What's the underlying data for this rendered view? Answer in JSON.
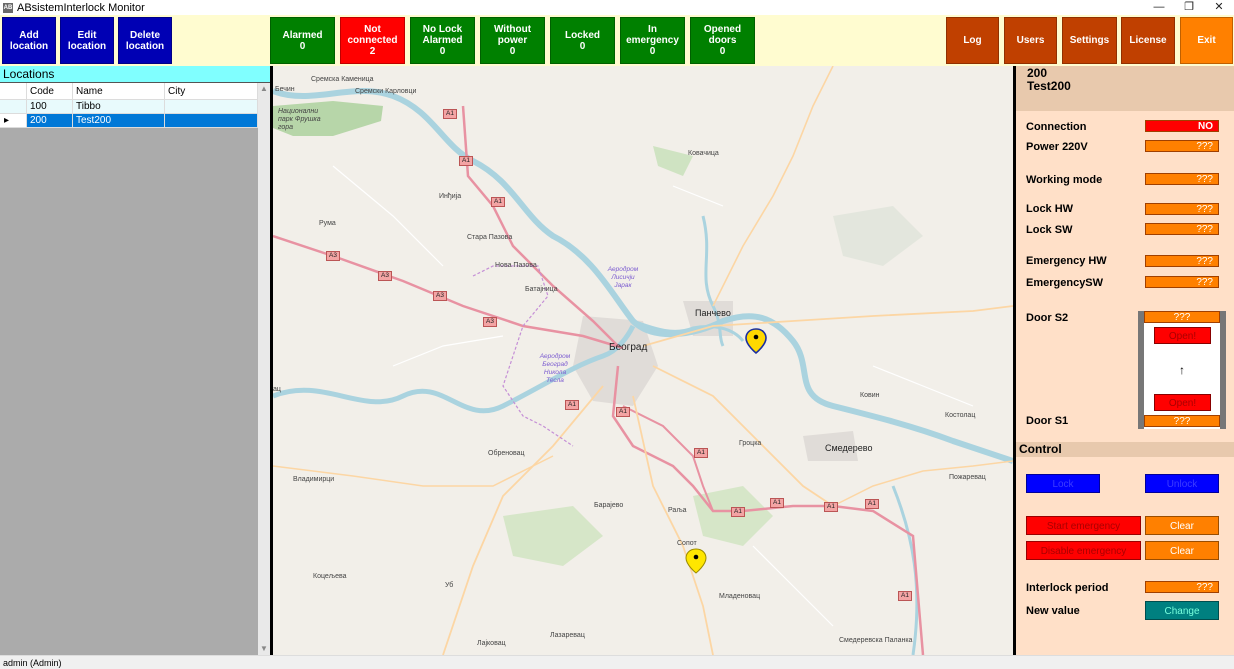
{
  "window": {
    "title": "ABsistemInterlock Monitor",
    "icon_text": "AB",
    "controls": [
      "minimize-icon",
      "maximize-icon",
      "close-icon"
    ]
  },
  "toolbar": {
    "add_location": [
      "Add",
      "location"
    ],
    "edit_location": [
      "Edit",
      "location"
    ],
    "delete_location": [
      "Delete",
      "location"
    ],
    "alarmed": {
      "label": "Alarmed",
      "count": "0"
    },
    "not_connected": {
      "label": [
        "Not",
        "connected"
      ],
      "count": "2"
    },
    "no_lock_alarmed": {
      "label": [
        "No Lock",
        "Alarmed"
      ],
      "count": "0"
    },
    "without_power": {
      "label": [
        "Without",
        "power"
      ],
      "count": "0"
    },
    "locked": {
      "label": "Locked",
      "count": "0"
    },
    "in_emergency": {
      "label": [
        "In",
        "emergency"
      ],
      "count": "0"
    },
    "opened_doors": {
      "label": [
        "Opened",
        "doors"
      ],
      "count": "0"
    },
    "log": "Log",
    "users": "Users",
    "settings": "Settings",
    "license": "License",
    "exit": "Exit"
  },
  "locations": {
    "title": "Locations",
    "columns": [
      "Code",
      "Name",
      "City"
    ],
    "rows": [
      {
        "code": "100",
        "name": "Tibbo",
        "city": ""
      },
      {
        "code": "200",
        "name": "Test200",
        "city": ""
      }
    ],
    "selected_row_marker": "▸"
  },
  "map": {
    "labels": {
      "sremska_kamenica": "Сремска Каменица",
      "sremski_karlovci": "Сремски Карловци",
      "becin": "Бечин",
      "nac_park": "Национални парк Фрушка гора",
      "kovacica": "Ковачица",
      "indjija": "Инђија",
      "ruma": "Рума",
      "stara_pazova": "Стара Пазова",
      "nova_pazova": "Нова Пазова",
      "batajnica": "Батајница",
      "pancevo": "Панчево",
      "beograd": "Београд",
      "obrenovac": "Обреновац",
      "kovin": "Ковин",
      "kostolac": "Костолац",
      "grocka": "Гроцка",
      "smederevo": "Смедерево",
      "vladimirci": "Владимирци",
      "pozarevac": "Пожаревац",
      "barajevo": "Барајево",
      "ralja": "Раља",
      "sopot": "Сопот",
      "koceljeva": "Коцељева",
      "ub": "Уб",
      "mladenovac": "Младеновац",
      "lajkovac": "Лајковац",
      "lazarevac": "Лазаревац",
      "smederevska_palanka": "Смедеревска Паланка",
      "vac": "ац",
      "airport_lisicji": "Аеродром Лисичји Јарак",
      "airport_tesla": "Аеродром Београд Никола Тесла"
    },
    "road_signs": {
      "a1": "A1",
      "a3": "A3"
    },
    "pins": [
      "map-marker-blue-icon",
      "map-marker-yellow-icon"
    ],
    "colors": {
      "land": "#f2efe9",
      "water": "#aad3df",
      "forest": "#add19e",
      "motorway": "#e892a2",
      "primary": "#fcd6a4"
    }
  },
  "details": {
    "code": "200",
    "name": "Test200",
    "connection": {
      "label": "Connection",
      "value": "NO"
    },
    "power": {
      "label": "Power 220V",
      "value": "???"
    },
    "working_mode": {
      "label": "Working mode",
      "value": "???"
    },
    "lock_hw": {
      "label": "Lock HW",
      "value": "???"
    },
    "lock_sw": {
      "label": "Lock SW",
      "value": "???"
    },
    "emergency_hw": {
      "label": "Emergency HW",
      "value": "???"
    },
    "emergency_sw": {
      "label": "EmergencySW",
      "value": "???"
    },
    "door_s2": {
      "label": "Door S2",
      "value": "???",
      "button": "Open!"
    },
    "door_s1": {
      "label": "Door S1",
      "value": "???",
      "button": "Open!"
    },
    "door_arrow": "↑"
  },
  "control": {
    "title": "Control",
    "lock": "Lock",
    "unlock": "Unlock",
    "start_emergency": "Start emergency",
    "disable_emergency": "Disable emergency",
    "clear1": "Clear",
    "clear2": "Clear",
    "interlock_period": {
      "label": "Interlock period",
      "value": "???"
    },
    "new_value": {
      "label": "New value",
      "button": "Change"
    }
  },
  "status": {
    "user": "admin (Admin)"
  }
}
